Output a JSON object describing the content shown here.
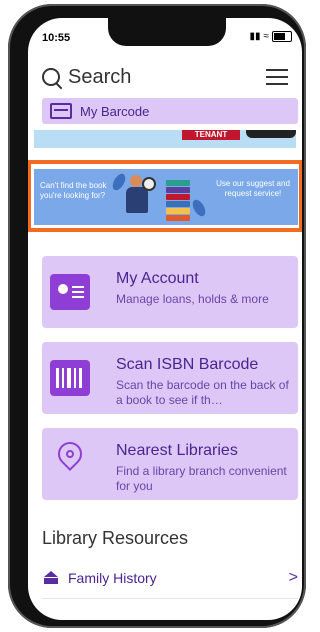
{
  "status": {
    "time": "10:55"
  },
  "header": {
    "search_label": "Search"
  },
  "barcode_bar": {
    "label": "My Barcode"
  },
  "top_banner": {
    "text": "TENANT"
  },
  "promo_banner": {
    "left_text": "Can't find the book you're looking for?",
    "right_text": "Use our suggest and request service!"
  },
  "menu": [
    {
      "title": "My Account",
      "description": "Manage loans, holds & more"
    },
    {
      "title": "Scan ISBN Barcode",
      "description": "Scan the barcode on the back of a book to see if th…"
    },
    {
      "title": "Nearest Libraries",
      "description": "Find a library branch convenient for you"
    }
  ],
  "resources": {
    "section_title": "Library Resources",
    "items": [
      {
        "label": "Family History",
        "chevron": ">"
      }
    ]
  },
  "colors": {
    "accent": "#8e3ed4",
    "card_bg": "#dcc7f6",
    "highlight": "#f36b21"
  }
}
